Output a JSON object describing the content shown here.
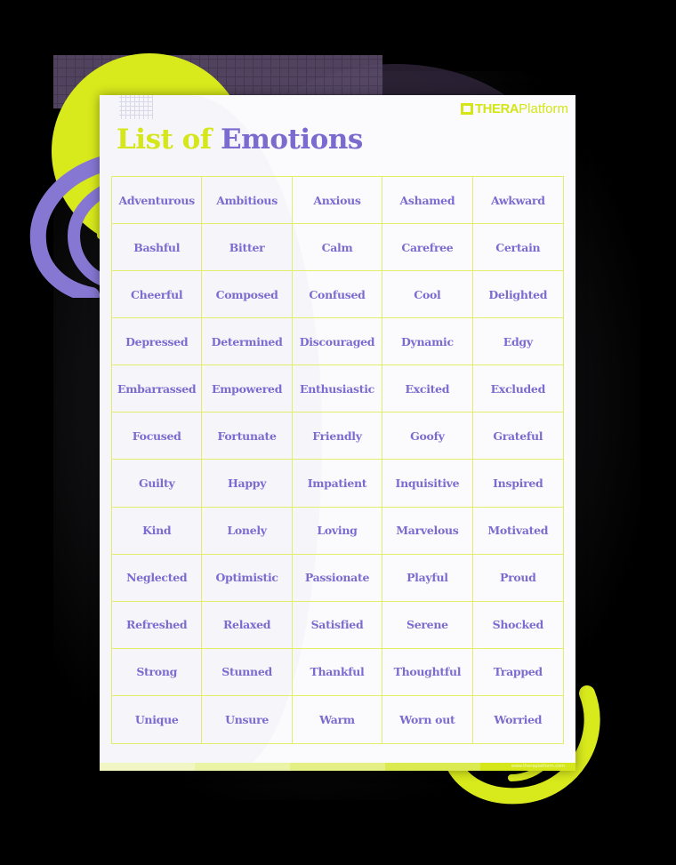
{
  "brand": {
    "logo_bold": "THERA",
    "logo_light": "Platform",
    "footer_url": "www.theraplatform.com",
    "colors": {
      "lime": "#d5e71b",
      "purple": "#7b6bcf",
      "grid_border": "#e2ee6a",
      "background": "#000000",
      "sheet": "#fbfbfd"
    }
  },
  "title": {
    "part1": "List of",
    "part2": "Emotions"
  },
  "emotions": [
    [
      "Adventurous",
      "Ambitious",
      "Anxious",
      "Ashamed",
      "Awkward"
    ],
    [
      "Bashful",
      "Bitter",
      "Calm",
      "Carefree",
      "Certain"
    ],
    [
      "Cheerful",
      "Composed",
      "Confused",
      "Cool",
      "Delighted"
    ],
    [
      "Depressed",
      "Determined",
      "Discouraged",
      "Dynamic",
      "Edgy"
    ],
    [
      "Embarrassed",
      "Empowered",
      "Enthusiastic",
      "Excited",
      "Excluded"
    ],
    [
      "Focused",
      "Fortunate",
      "Friendly",
      "Goofy",
      "Grateful"
    ],
    [
      "Guilty",
      "Happy",
      "Impatient",
      "Inquisitive",
      "Inspired"
    ],
    [
      "Kind",
      "Lonely",
      "Loving",
      "Marvelous",
      "Motivated"
    ],
    [
      "Neglected",
      "Optimistic",
      "Passionate",
      "Playful",
      "Proud"
    ],
    [
      "Refreshed",
      "Relaxed",
      "Satisfied",
      "Serene",
      "Shocked"
    ],
    [
      "Strong",
      "Stunned",
      "Thankful",
      "Thoughtful",
      "Trapped"
    ],
    [
      "Unique",
      "Unsure",
      "Warm",
      "Worn out",
      "Worried"
    ]
  ],
  "footer_segments": [
    "#f1f6c4",
    "#eaf3a6",
    "#e4ef85",
    "#dcea52",
    "#d5e71b"
  ]
}
